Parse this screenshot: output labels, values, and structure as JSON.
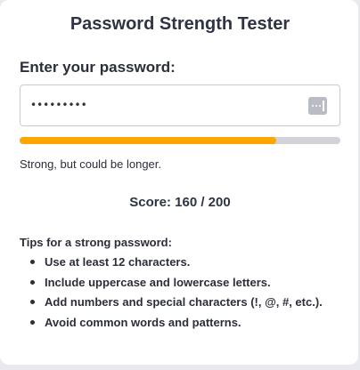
{
  "app": {
    "title": "Password Strength Tester"
  },
  "form": {
    "label": "Enter your password:",
    "password_masked": "•••••••••",
    "reveal_icon": "password-reveal-icon"
  },
  "strength": {
    "progress_fraction": 0.8,
    "bar_color": "#ffa500",
    "track_color": "#d2d3d6",
    "feedback": "Strong, but could be longer."
  },
  "score": {
    "text": "Score: 160 / 200"
  },
  "tips": {
    "title": "Tips for a strong password:",
    "items": [
      "Use at least 12 characters.",
      "Include uppercase and lowercase letters.",
      "Add numbers and special characters (!, @, #, etc.).",
      "Avoid common words and patterns."
    ]
  }
}
